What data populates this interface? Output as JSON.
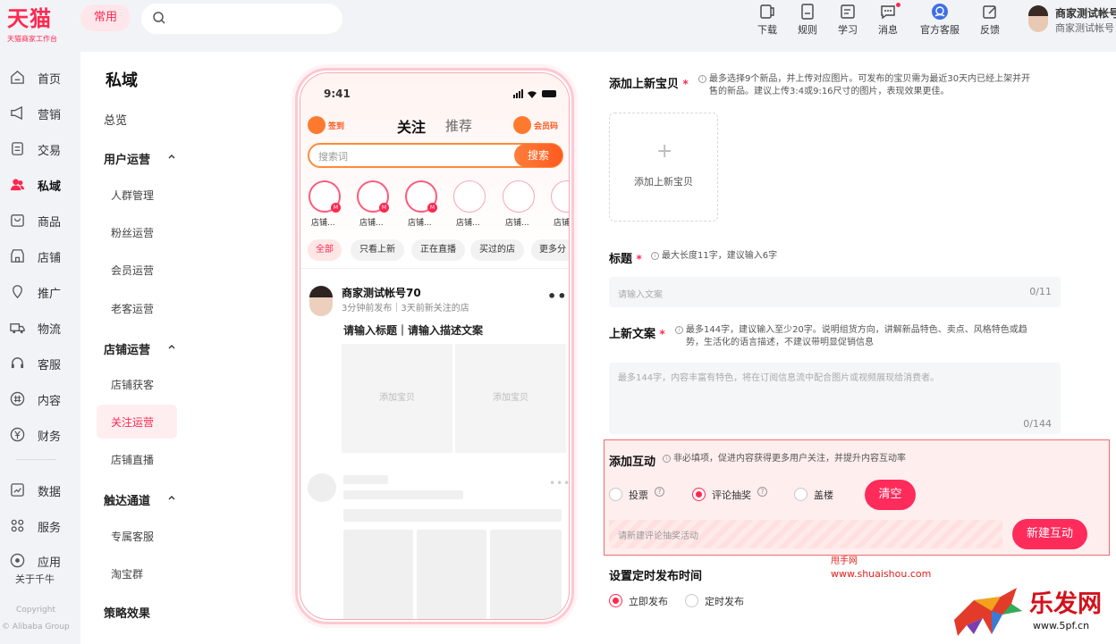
{
  "brand": {
    "name": "天猫",
    "subtitle": "天猫商家工作台",
    "primary_color": "#ff2850"
  },
  "header": {
    "common_label": "常用",
    "search_placeholder": "",
    "tools": [
      {
        "label": "下载",
        "icon": "tablet-icon"
      },
      {
        "label": "规则",
        "icon": "book-icon"
      },
      {
        "label": "学习",
        "icon": "notebook-icon"
      },
      {
        "label": "消息",
        "icon": "chat-icon"
      },
      {
        "label": "官方客服",
        "icon": "customer-service-icon"
      },
      {
        "label": "反馈",
        "icon": "feedback-icon"
      }
    ],
    "account": {
      "name": "商家测试帐号",
      "sub": "商家测试帐号"
    }
  },
  "left_nav": {
    "items": [
      {
        "label": "首页",
        "icon": "home-icon"
      },
      {
        "label": "营销",
        "icon": "megaphone-icon"
      },
      {
        "label": "交易",
        "icon": "receipt-icon"
      },
      {
        "label": "私域",
        "icon": "users-icon"
      },
      {
        "label": "商品",
        "icon": "goods-icon"
      },
      {
        "label": "店铺",
        "icon": "store-icon"
      },
      {
        "label": "推广",
        "icon": "location-icon"
      },
      {
        "label": "物流",
        "icon": "truck-icon"
      },
      {
        "label": "客服",
        "icon": "headset-icon"
      },
      {
        "label": "内容",
        "icon": "hash-icon"
      },
      {
        "label": "财务",
        "icon": "yen-icon"
      },
      {
        "label": "数据",
        "icon": "chart-icon"
      },
      {
        "label": "服务",
        "icon": "grid-icon"
      },
      {
        "label": "应用",
        "icon": "apps-icon"
      }
    ],
    "active_index": 3,
    "about": "关于千牛",
    "copyright1": "Copyright",
    "copyright2": "© Alibaba Group"
  },
  "sub_nav": {
    "title": "私域",
    "overview": "总览",
    "groups": [
      {
        "label": "用户运营",
        "children": [
          "人群管理",
          "粉丝运营",
          "会员运营",
          "老客运营"
        ]
      },
      {
        "label": "店铺运营",
        "children": [
          "店铺获客",
          "关注运营",
          "店铺直播"
        ]
      },
      {
        "label": "触达通道",
        "children": [
          "专属客服",
          "淘宝群"
        ]
      }
    ],
    "strategy": "策略效果",
    "active_child": "关注运营"
  },
  "phone": {
    "time": "9:41",
    "sign_label": "签到",
    "tab_follow": "关注",
    "tab_recommend": "推荐",
    "member_label": "会员码",
    "search_placeholder": "搜索词",
    "search_button": "搜索",
    "stories": [
      {
        "label": "店铺...",
        "badge": "M",
        "filled": true
      },
      {
        "label": "店铺...",
        "badge": "M",
        "filled": true
      },
      {
        "label": "店铺...",
        "badge": "M",
        "filled": true
      },
      {
        "label": "店铺...",
        "badge": "",
        "filled": false
      },
      {
        "label": "店铺...",
        "badge": "",
        "filled": false
      },
      {
        "label": "店铺...",
        "badge": "",
        "filled": false
      }
    ],
    "chips": [
      "全部",
      "只看上新",
      "正在直播",
      "买过的店",
      "更多分"
    ],
    "post": {
      "name": "商家测试帐号70",
      "meta": "3分钟前发布｜3天前新关注的店",
      "title": "请输入标题｜请输入描述文案",
      "slot1": "添加宝贝",
      "slot2": "添加宝贝"
    }
  },
  "form": {
    "new_items": {
      "label": "添加上新宝贝",
      "required_mark": "*",
      "hint_line1": "最多选择9个新品，并上传对应图片。可发布的宝贝需为最近30天内已经上架并开",
      "hint_line2": "售的新品。建议上传3:4或9:16尺寸的图片，表现效果更佳。",
      "upload_label": "添加上新宝贝"
    },
    "title": {
      "label": "标题",
      "required_mark": "*",
      "hint": "最大长度11字，建议输入6字",
      "placeholder": "请输入文案",
      "count": "0/11"
    },
    "copy": {
      "label": "上新文案",
      "required_mark": "*",
      "hint_line1": "最多144字，建议输入至少20字。说明组货方向，讲解新品特色、卖点、风格特色或趋",
      "hint_line2": "势，生活化的语言描述，不建议带明显促销信息",
      "placeholder": "最多144字，内容丰富有特色，将在订阅信息流中配合图片或视频展现给消费者。",
      "count": "0/144"
    },
    "interaction": {
      "label": "添加互动",
      "hint": "非必填项，促进内容获得更多用户关注，并提升内容互动率",
      "options": [
        "投票",
        "评论抽奖",
        "盖楼"
      ],
      "selected": "评论抽奖",
      "clear_button": "清空",
      "input_placeholder": "请新建评论抽奖活动",
      "create_button": "新建互动"
    },
    "schedule": {
      "label": "设置定时发布时间",
      "options": [
        "立即发布",
        "定时发布"
      ],
      "selected": "立即发布"
    }
  },
  "watermark": {
    "line1": "甩手网",
    "line2": "www.shuaishou.com",
    "logo_text": "乐发网",
    "logo_url": "www.5pf.cn"
  }
}
